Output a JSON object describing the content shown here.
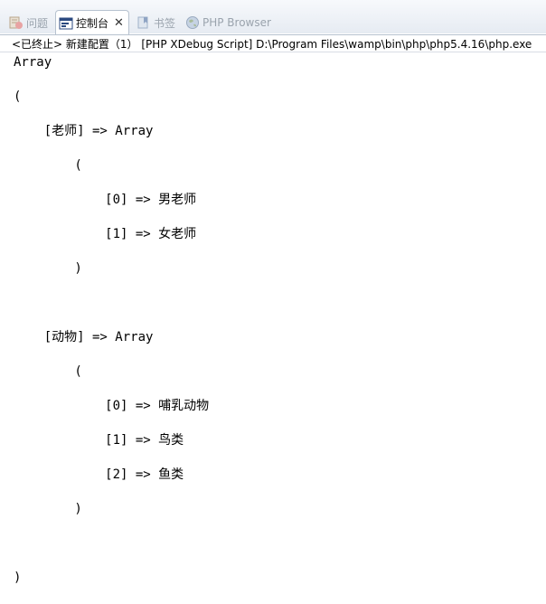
{
  "tabs": [
    {
      "label": "问题",
      "icon": "problems-icon",
      "active": false
    },
    {
      "label": "控制台",
      "icon": "console-icon",
      "active": true
    },
    {
      "label": "书签",
      "icon": "bookmarks-icon",
      "active": false
    },
    {
      "label": "PHP Browser",
      "icon": "globe-icon",
      "active": false
    }
  ],
  "console_tab_close": "✕",
  "status_line": "<已终止> 新建配置（1） [PHP XDebug Script] D:\\Program Files\\wamp\\bin\\php\\php5.4.16\\php.exe",
  "console_lines": [
    "Array",
    "(",
    "    [老师] => Array",
    "        (",
    "            [0] => 男老师",
    "            [1] => 女老师",
    "        )",
    "",
    "    [动物] => Array",
    "        (",
    "            [0] => 哺乳动物",
    "            [1] => 鸟类",
    "            [2] => 鱼类",
    "        )",
    "",
    ")"
  ],
  "colors": {
    "tab_bar": "#e6ebf2",
    "active_tab": "#ffffff",
    "border": "#b7c2cf"
  }
}
